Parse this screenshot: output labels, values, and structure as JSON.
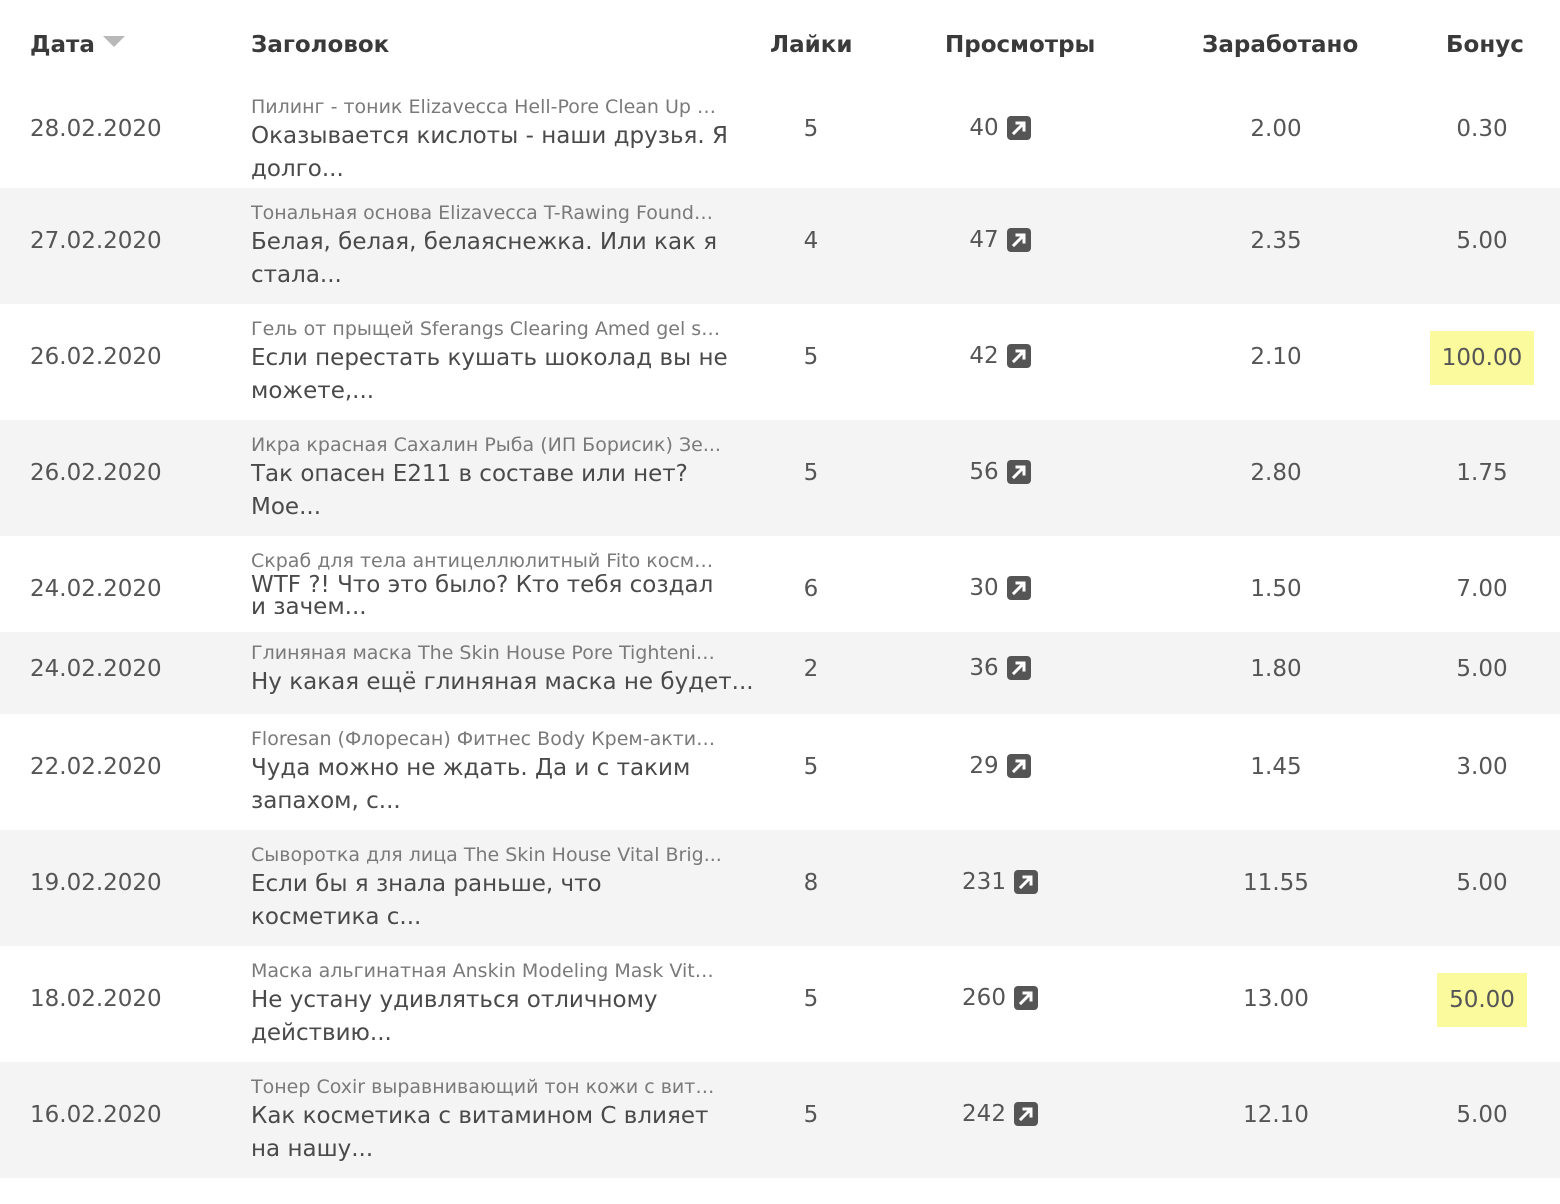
{
  "header": {
    "date": "Дата",
    "title": "Заголовок",
    "likes": "Лайки",
    "views": "Просмотры",
    "earned": "Заработано",
    "bonus": "Бонус"
  },
  "rows": [
    {
      "date": "28.02.2020",
      "product": "Пилинг - тоник Elizavecca Hell-Pore Clean Up A...",
      "review": "Оказывается кислоты - наши друзья. Я долго...",
      "likes": "5",
      "views": "40",
      "earned": "2.00",
      "bonus": "0.30",
      "highlight": false
    },
    {
      "date": "27.02.2020",
      "product": "Тональная основа Elizavecca T-Rawing Founda...",
      "review": "Белая, белая, белаяснежка. Или как я стала...",
      "likes": "4",
      "views": "47",
      "earned": "2.35",
      "bonus": "5.00",
      "highlight": false
    },
    {
      "date": "26.02.2020",
      "product": "Гель от прыщей Sferangs Clearing Amed gel sp...",
      "review": "Если перестать кушать шоколад вы не можете,...",
      "likes": "5",
      "views": "42",
      "earned": "2.10",
      "bonus": "100.00",
      "highlight": true
    },
    {
      "date": "26.02.2020",
      "product": "Икра красная Сахалин Рыба (ИП Борисик) Зе...",
      "review": "Так опасен Е211 в составе или нет? Мое...",
      "likes": "5",
      "views": "56",
      "earned": "2.80",
      "bonus": "1.75",
      "highlight": false
    },
    {
      "date": "24.02.2020",
      "product": "Скраб для тела антицеллюлитный Fito космет...",
      "review": "WTF ?! Что это было? Кто тебя создал и зачем...",
      "likes": "6",
      "views": "30",
      "earned": "1.50",
      "bonus": "7.00",
      "highlight": false
    },
    {
      "date": "24.02.2020",
      "product": "Глиняная маска The Skin House Pore Tightenin...",
      "review": "Ну какая ещё глиняная маска не будет...",
      "likes": "2",
      "views": "36",
      "earned": "1.80",
      "bonus": "5.00",
      "highlight": false
    },
    {
      "date": "22.02.2020",
      "product": "Floresan (Флоресан) Фитнес Body Крем-актив ...",
      "review": "Чуда можно не ждать. Да и с таким запахом, с...",
      "likes": "5",
      "views": "29",
      "earned": "1.45",
      "bonus": "3.00",
      "highlight": false
    },
    {
      "date": "19.02.2020",
      "product": "Сыворотка для лица The Skin House Vital Brig...",
      "review": "Если бы я знала раньше, что косметика с...",
      "likes": "8",
      "views": "231",
      "earned": "11.55",
      "bonus": "5.00",
      "highlight": false
    },
    {
      "date": "18.02.2020",
      "product": "Маска альгинатная Anskin Modeling Mask Vita...",
      "review": "Не устану удивляться отличному действию...",
      "likes": "5",
      "views": "260",
      "earned": "13.00",
      "bonus": "50.00",
      "highlight": true
    },
    {
      "date": "16.02.2020",
      "product": "Тонер Coxir выравнивающий тон кожи с вита...",
      "review": "Как косметика с витамином С влияет на нашу...",
      "likes": "5",
      "views": "242",
      "earned": "12.10",
      "bonus": "5.00",
      "highlight": false
    }
  ]
}
